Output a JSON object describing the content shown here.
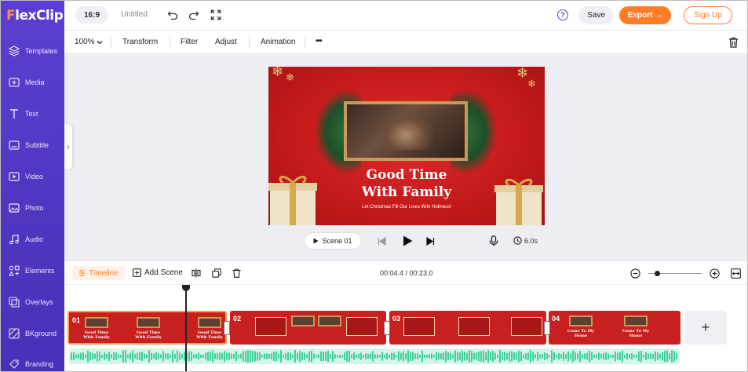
{
  "brand": {
    "logo_f": "F",
    "logo_rest": "lexClip",
    "accent": "#5b3fd0",
    "orange": "#ff7d27"
  },
  "sidebar": {
    "items": [
      {
        "label": "Templates",
        "icon": "layers-icon"
      },
      {
        "label": "Media",
        "icon": "media-add-icon"
      },
      {
        "label": "Text",
        "icon": "text-icon"
      },
      {
        "label": "Subtitle",
        "icon": "subtitle-icon"
      },
      {
        "label": "Video",
        "icon": "video-icon"
      },
      {
        "label": "Photo",
        "icon": "photo-icon"
      },
      {
        "label": "Audio",
        "icon": "music-icon"
      },
      {
        "label": "Elements",
        "icon": "elements-icon"
      },
      {
        "label": "Overlays",
        "icon": "overlays-icon"
      },
      {
        "label": "BKground",
        "icon": "background-icon"
      },
      {
        "label": "Branding",
        "icon": "branding-icon"
      }
    ]
  },
  "topbar": {
    "ratio": "16:9",
    "title": "Untitled",
    "help": "?",
    "save": "Save",
    "export": "Export →",
    "signup": "Sign Up"
  },
  "toolbar": {
    "zoom": "100%",
    "transform": "Transform",
    "filter": "Filter",
    "adjust": "Adjust",
    "animation": "Animation",
    "more": "•••"
  },
  "canvas": {
    "title_line1": "Good Time",
    "title_line2": "With Family",
    "subtitle": "Let Christmas Fill Our Lives With Holiness!"
  },
  "player": {
    "scene": "Scene 01",
    "duration": "6.0s"
  },
  "timeline": {
    "tab": "Timeline",
    "add_scene": "Add Scene",
    "time": "00:04.4 / 00:23.0",
    "clips": [
      {
        "num": "01"
      },
      {
        "num": "02"
      },
      {
        "num": "03"
      },
      {
        "num": "04"
      }
    ],
    "thumb_text_1": "Good Time With Family",
    "thumb_text_4": "Come To My Home",
    "add_clip": "+"
  }
}
